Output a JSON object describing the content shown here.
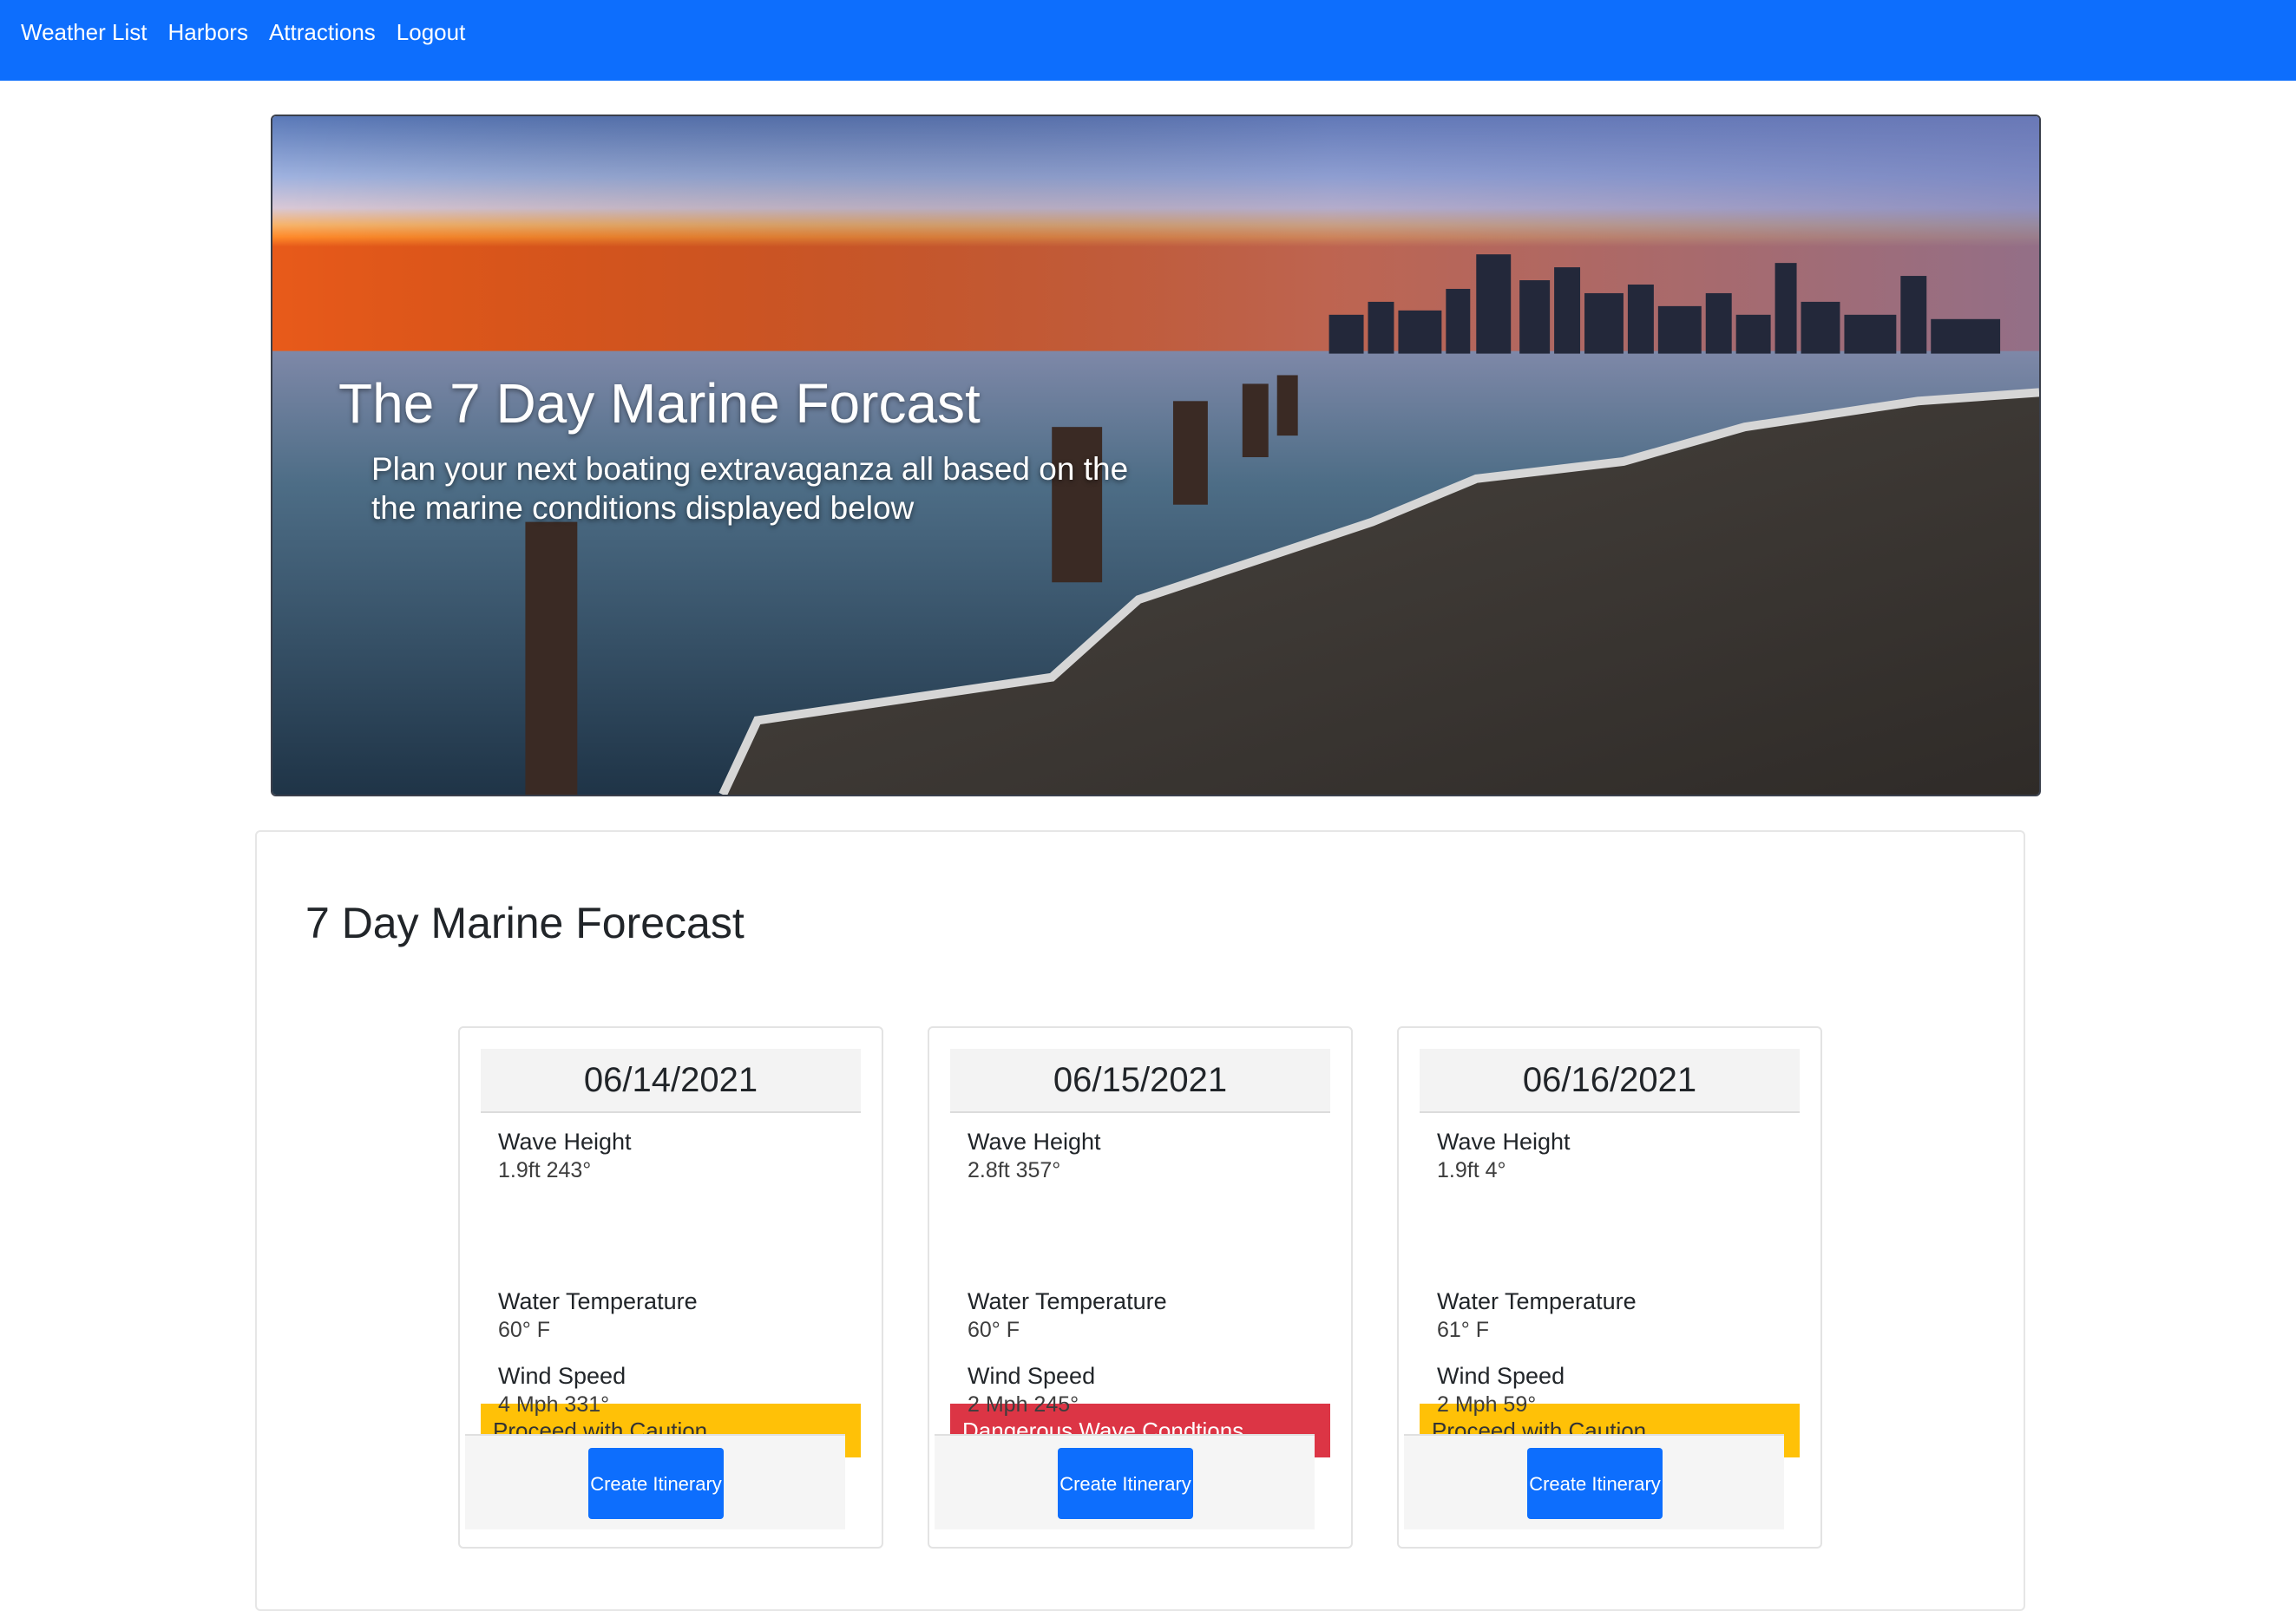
{
  "nav": {
    "items": [
      {
        "label": "Weather List"
      },
      {
        "label": "Harbors"
      },
      {
        "label": "Attractions"
      },
      {
        "label": "Logout"
      }
    ]
  },
  "hero": {
    "title": "The 7 Day Marine Forcast",
    "subtitle": "Plan your next boating extravaganza all based on the the marine conditions displayed below"
  },
  "forecast": {
    "heading": "7 Day Marine Forecast",
    "labels": {
      "wave_height": "Wave Height",
      "water_temperature": "Water Temperature",
      "wind_speed": "Wind Speed",
      "button": "Create Itinerary"
    },
    "days": [
      {
        "date": "06/14/2021",
        "wave": "1.9ft 243°",
        "alert": "Proceed with Caution",
        "alert_level": "caution",
        "water_temp": "60° F",
        "wind": "4 Mph 331°"
      },
      {
        "date": "06/15/2021",
        "wave": "2.8ft 357°",
        "alert": "Dangerous Wave Condtions",
        "alert_level": "danger",
        "water_temp": "60° F",
        "wind": "2 Mph 245°"
      },
      {
        "date": "06/16/2021",
        "wave": "1.9ft 4°",
        "alert": "Proceed with Caution",
        "alert_level": "caution",
        "water_temp": "61° F",
        "wind": "2 Mph 59°"
      }
    ]
  },
  "colors": {
    "navbar": "#0d6efd",
    "caution": "#ffc107",
    "danger": "#dc3545",
    "button": "#0d6efd"
  }
}
